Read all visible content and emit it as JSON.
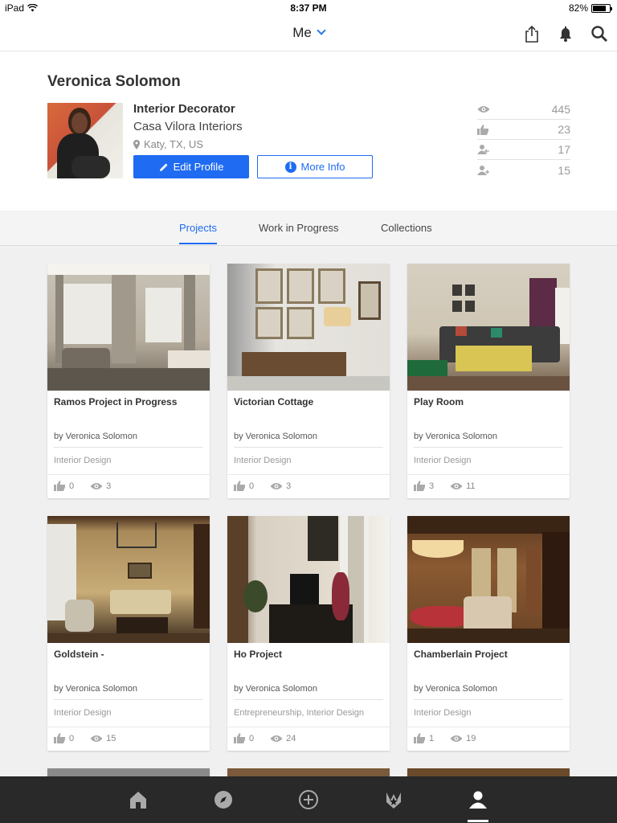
{
  "status": {
    "device": "iPad",
    "time": "8:37 PM",
    "battery": "82%"
  },
  "nav": {
    "title": "Me"
  },
  "profile": {
    "name": "Veronica Solomon",
    "title": "Interior Decorator",
    "company": "Casa Vilora Interiors",
    "location": "Katy, TX, US",
    "edit_label": "Edit Profile",
    "info_label": "More Info",
    "stats": [
      {
        "icon": "eye-icon",
        "value": "445"
      },
      {
        "icon": "thumbs-up-icon",
        "value": "23"
      },
      {
        "icon": "follower-icon",
        "value": "17"
      },
      {
        "icon": "following-icon",
        "value": "15"
      }
    ]
  },
  "tabs": [
    "Projects",
    "Work in Progress",
    "Collections"
  ],
  "cards": [
    {
      "title": "Ramos Project in Progress",
      "by": "by Veronica Solomon",
      "category": "Interior Design",
      "likes": "0",
      "views": "3"
    },
    {
      "title": "Victorian Cottage",
      "by": "by Veronica Solomon",
      "category": "Interior Design",
      "likes": "0",
      "views": "3"
    },
    {
      "title": "Play Room",
      "by": "by Veronica Solomon",
      "category": "Interior Design",
      "likes": "3",
      "views": "11"
    },
    {
      "title": "Goldstein -",
      "by": "by Veronica Solomon",
      "category": "Interior Design",
      "likes": "0",
      "views": "15"
    },
    {
      "title": "Ho Project",
      "by": "by Veronica Solomon",
      "category": "Entrepreneurship, Interior Design",
      "likes": "0",
      "views": "24"
    },
    {
      "title": "Chamberlain Project",
      "by": "by Veronica Solomon",
      "category": "Interior Design",
      "likes": "1",
      "views": "19"
    }
  ],
  "colors": {
    "accent": "#1f6bf2",
    "tabbar": "#1e1e1e"
  }
}
